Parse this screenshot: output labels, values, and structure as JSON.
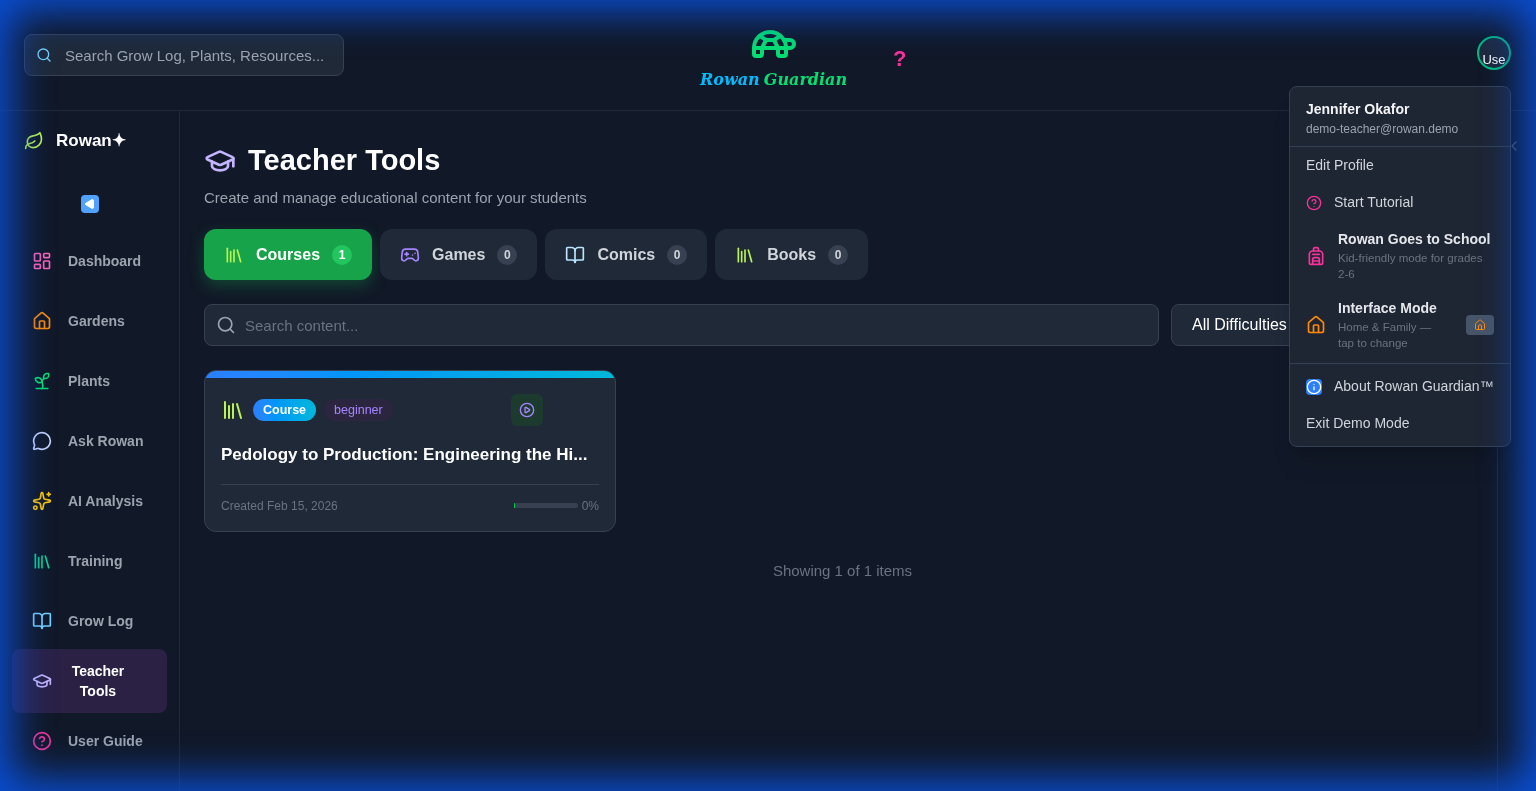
{
  "header": {
    "search": {
      "placeholder": "Search Grow Log, Plants, Resources..."
    },
    "logo": {
      "word_1": "Rowan",
      "word_2": "Guardian"
    },
    "help": "?",
    "avatar_alt": "Use"
  },
  "sidebar": {
    "brand": "Rowan✦",
    "items": [
      {
        "label": "Dashboard",
        "selected": false
      },
      {
        "label": "Gardens",
        "selected": false
      },
      {
        "label": "Plants",
        "selected": false
      },
      {
        "label": "Ask Rowan",
        "selected": false
      },
      {
        "label": "AI Analysis",
        "selected": false
      },
      {
        "label": "Training",
        "selected": false
      },
      {
        "label": "Grow Log",
        "selected": false
      },
      {
        "label": "Teacher Tools",
        "selected": true
      },
      {
        "label": "User Guide",
        "selected": false
      }
    ]
  },
  "page": {
    "title": "Teacher Tools",
    "subtitle": "Create and manage educational content for your students",
    "tabs": [
      {
        "label": "Courses",
        "count": "1",
        "selected": true
      },
      {
        "label": "Games",
        "count": "0",
        "selected": false
      },
      {
        "label": "Comics",
        "count": "0",
        "selected": false
      },
      {
        "label": "Books",
        "count": "0",
        "selected": false
      }
    ],
    "search": {
      "placeholder": "Search content..."
    },
    "difficulty": "All Difficulties",
    "cards": [
      {
        "type": "Course",
        "difficulty": "beginner",
        "title": "Pedology to Production: Engineering the Hi...",
        "created": "Created Feb 15, 2026",
        "level": 0,
        "progress": "0%"
      }
    ],
    "footer": "Showing 1 of 1 items"
  },
  "user_menu": {
    "name": "Jennifer Okafor",
    "email": "demo-teacher@rowan.demo",
    "items": [
      {
        "kind": "plain",
        "label": "Edit Profile"
      },
      {
        "kind": "icon",
        "label": "Start Tutorial"
      },
      {
        "kind": "detail",
        "label": "Rowan Goes to School",
        "description": "Kid-friendly mode for grades 2-6"
      },
      {
        "kind": "mode",
        "label": "Interface Mode",
        "description": "Home & Family — tap to change"
      },
      {
        "kind": "divider"
      },
      {
        "kind": "icon",
        "label": "About Rowan Guardian™"
      },
      {
        "kind": "plain",
        "label": "Exit Demo Mode"
      }
    ]
  }
}
